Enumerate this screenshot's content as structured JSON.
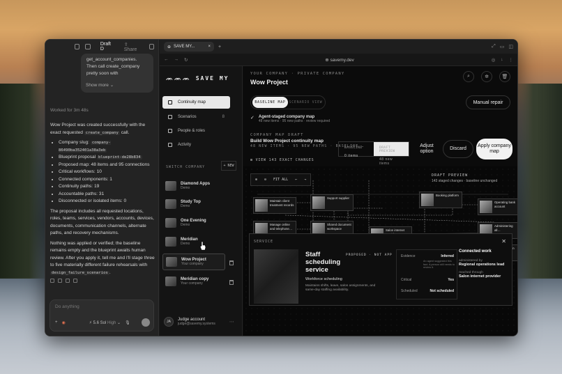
{
  "left": {
    "top_title": "Draft D",
    "share_label": "Share",
    "bubble_lines": [
      "get_account_companies.",
      "Then call create_company",
      "pretty soon with"
    ],
    "show_more": "Show more",
    "worked_for": "Worked for 3m 48s",
    "intro_a": "Wow Project was created successfully with the exact requested ",
    "intro_code": "create_company",
    "intro_b": " call.",
    "bullets": {
      "slug_label": "Company slug: ",
      "slug_value": "company-86490ba352401a38a3eb",
      "blueprint_label": "Blueprint proposal ",
      "blueprint_value": "blueprint-de28b834",
      "proposed": "Proposed map: 48 items and 95 connections",
      "critical": "Critical workflows: 10",
      "connected": "Connected components: 1",
      "continuity": "Continuity paths: 19",
      "accountable": "Accountable paths: 31",
      "disconnected": "Disconnected or isolated items: 0"
    },
    "para2": "The proposal includes all requested locations, roles, teams, services, vendors, accounts, devices, documents, communication channels, alternate paths, and recovery mechanisms.",
    "para3_a": "Nothing was applied or verified; the baseline remains empty and the blueprint awaits human review. After you apply it, tell me and I'll stage three to five materially different failure rehearsals with ",
    "para3_code": "design_failure_scenarios",
    "para3_b": ".",
    "composer_placeholder": "Do anything",
    "model_label": "5.6 Sol",
    "effort_label": "High"
  },
  "browser": {
    "tab_title": "SAVE MY...",
    "url": "savemy.dev"
  },
  "nav": {
    "brand": "SAVE MY",
    "items": [
      {
        "label": "Continuity map"
      },
      {
        "label": "Scenarios",
        "count": "8"
      },
      {
        "label": "People & roles"
      },
      {
        "label": "Activity"
      }
    ],
    "switch_label": "SWITCH COMPANY",
    "new_label": "+ NEW",
    "companies": [
      {
        "name": "Diamond Apps",
        "sub": "Demo"
      },
      {
        "name": "Study Top",
        "sub": "Demo"
      },
      {
        "name": "One Evening",
        "sub": "Demo"
      },
      {
        "name": "Meridian",
        "sub": "Demo"
      },
      {
        "name": "Wow Project",
        "sub": "Your company"
      },
      {
        "name": "Meridian copy",
        "sub": "Your company"
      }
    ],
    "user_initials": "JA",
    "user_name": "Judge account",
    "user_email": "judge@savemy.systems"
  },
  "main": {
    "eyebrow": "YOUR COMPANY · PRIVATE COMPANY",
    "title": "Wow Project",
    "seg_baseline": "BASELINE MAP",
    "seg_scenario": "SCENARIO VIEW",
    "manual_repair": "Manual repair",
    "agent_title": "Agent-staged company map",
    "agent_desc": "48 new items · 95 new paths · review required",
    "draft_eyebrow": "COMPANY MAP DRAFT",
    "draft_title": "Build Wow Project continuity map",
    "draft_meta": "48 NEW ITEMS · 95 NEW PATHS · BASELINE …",
    "baseline_label": "BASELINE",
    "baseline_value": "0 items",
    "preview_label": "DRAFT PREVIEW",
    "preview_value": "48 new items",
    "adjust": "Adjust option",
    "discard": "Discard",
    "apply": "Apply company map",
    "view_changes": "VIEW 143 EXACT CHANGES"
  },
  "canvas": {
    "fit": "FIT ALL",
    "preview_title": "DRAFT PREVIEW",
    "preview_desc": "143 staged changes · baseline unchanged",
    "cards": [
      "Maintain client treatment records",
      "Manage online and telephone…",
      "Open and close salon locations",
      "Shared document workspace",
      "Salon internet provider",
      "Operating bank account",
      "Administering all…",
      "Salon isolation channel",
      "Product supplier",
      "Booking platform",
      "Support supplier"
    ]
  },
  "panel": {
    "label": "SERVICE",
    "status": "PROPOSED · NOT APP",
    "title": "Staff scheduling service",
    "subtitle": "Workforce scheduling",
    "desc": "Maintains shifts, leave, salon assignments, and same-day staffing availability.",
    "evidence_label": "Evidence",
    "evidence_value": "Inferred",
    "evidence_note": "An agent suggested this fact. A person still needs to review it.",
    "critical_label": "Critical",
    "critical_value": "Yes",
    "scheduled_label": "Scheduled",
    "scheduled_value": "Not scheduled",
    "connected_title": "Connected work",
    "admin_label": "administered by",
    "admin_value": "Regional operations lead",
    "reached_label": "reached through",
    "reached_value": "Salon internet provider"
  }
}
